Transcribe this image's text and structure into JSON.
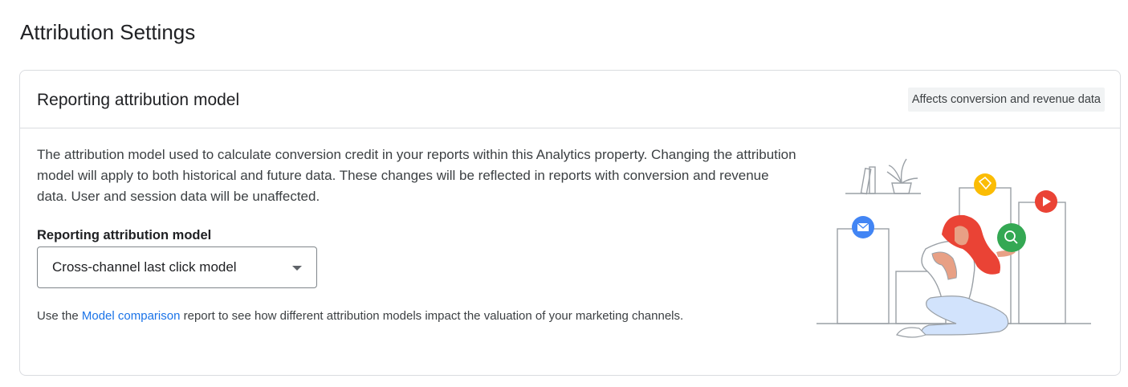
{
  "page": {
    "title": "Attribution Settings"
  },
  "card": {
    "title": "Reporting attribution model",
    "badge": "Affects conversion and revenue data",
    "description": "The attribution model used to calculate conversion credit in your reports within this Analytics property. Changing the attribution model will apply to both historical and future data. These changes will be reflected in reports with conversion and revenue data. User and session data will be unaffected.",
    "field_label": "Reporting attribution model",
    "select_value": "Cross-channel last click model",
    "hint_prefix": "Use the ",
    "hint_link": "Model comparison",
    "hint_suffix": " report to see how different attribution models impact the valuation of your marketing channels."
  },
  "illustration": {
    "icons": [
      "mail-icon",
      "tag-icon",
      "play-icon",
      "search-icon"
    ],
    "colors": {
      "mail": "#4285f4",
      "tag": "#fbbc04",
      "play": "#ea4335",
      "search": "#34a853",
      "hair": "#ea4335",
      "pants": "#d2e3fc",
      "line": "#9aa0a6"
    }
  }
}
